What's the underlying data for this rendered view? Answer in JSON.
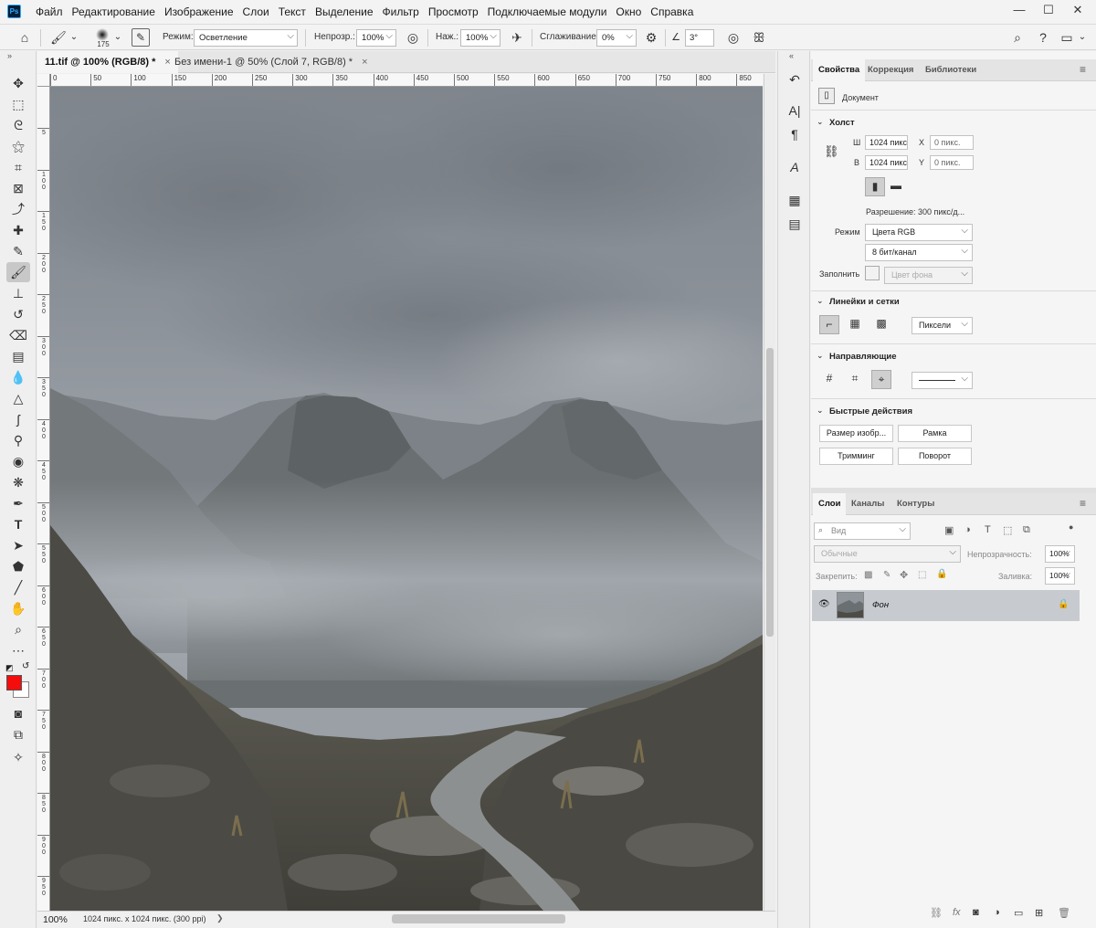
{
  "app": {
    "logo": "Ps"
  },
  "menu": [
    "Файл",
    "Редактирование",
    "Изображение",
    "Слои",
    "Текст",
    "Выделение",
    "Фильтр",
    "Просмотр",
    "Подключаемые модули",
    "Окно",
    "Справка"
  ],
  "window": {
    "minimize": "—",
    "maximize": "☐",
    "close": "✕"
  },
  "options": {
    "brush_size": "175",
    "mode_label": "Режим:",
    "mode_value": "Осветление",
    "opacity_label": "Непрозр.:",
    "opacity_value": "100%",
    "pressure_label": "Наж.:",
    "pressure_value": "100%",
    "smoothing_label": "Сглаживание:",
    "smoothing_value": "0%",
    "angle_value": "3°"
  },
  "tabs": [
    {
      "label": "11.tif @ 100% (RGB/8) *",
      "close": "×",
      "active": true
    },
    {
      "label": "Без имени-1 @ 50% (Слой 7, RGB/8) *",
      "close": "×",
      "active": false
    }
  ],
  "ruler": {
    "h": [
      "0",
      "50",
      "100",
      "150",
      "200",
      "250",
      "300",
      "350",
      "400",
      "450",
      "500",
      "550",
      "600",
      "650",
      "700",
      "750",
      "800",
      "850"
    ],
    "v": [
      "5",
      "1 0 0",
      "1 5 0",
      "2 0 0",
      "2 5 0",
      "3 0 0",
      "3 5 0",
      "4 0 0",
      "4 5 0",
      "5 0 0",
      "5 5 0",
      "6 0 0",
      "6 5 0",
      "7 0 0",
      "7 5 0",
      "8 0 0",
      "8 5 0",
      "9 0 0",
      "9 5 0"
    ]
  },
  "status": {
    "zoom": "100%",
    "info": "1024 пикс. x 1024 пикс. (300 ppi)",
    "arrow": "❯"
  },
  "properties": {
    "tabs": [
      "Свойства",
      "Коррекция",
      "Библиотеки"
    ],
    "document_label": "Документ",
    "canvas_section": "Холст",
    "w_label": "Ш",
    "w_value": "1024 пикс",
    "h_label": "В",
    "h_value": "1024 пикс",
    "x_label": "X",
    "x_value": "0 пикс.",
    "y_label": "Y",
    "y_value": "0 пикс.",
    "resolution": "Разрешение: 300 пикс/д...",
    "mode_label": "Режим",
    "mode_value": "Цвета RGB",
    "depth_value": "8 бит/канал",
    "fill_label": "Заполнить",
    "fill_value": "Цвет фона",
    "rulers_section": "Линейки и сетки",
    "units_value": "Пиксели",
    "guides_section": "Направляющие",
    "quick_section": "Быстрые действия",
    "actions": [
      "Размер изобр...",
      "Рамка",
      "Тримминг",
      "Поворот"
    ]
  },
  "layers": {
    "tabs": [
      "Слои",
      "Каналы",
      "Контуры"
    ],
    "filter_placeholder": "Вид",
    "blend_value": "Обычные",
    "opacity_label": "Непрозрачность:",
    "opacity_value": "100%",
    "lock_label": "Закрепить:",
    "fill_label": "Заливка:",
    "fill_value": "100%",
    "items": [
      {
        "name": "Фон"
      }
    ]
  }
}
